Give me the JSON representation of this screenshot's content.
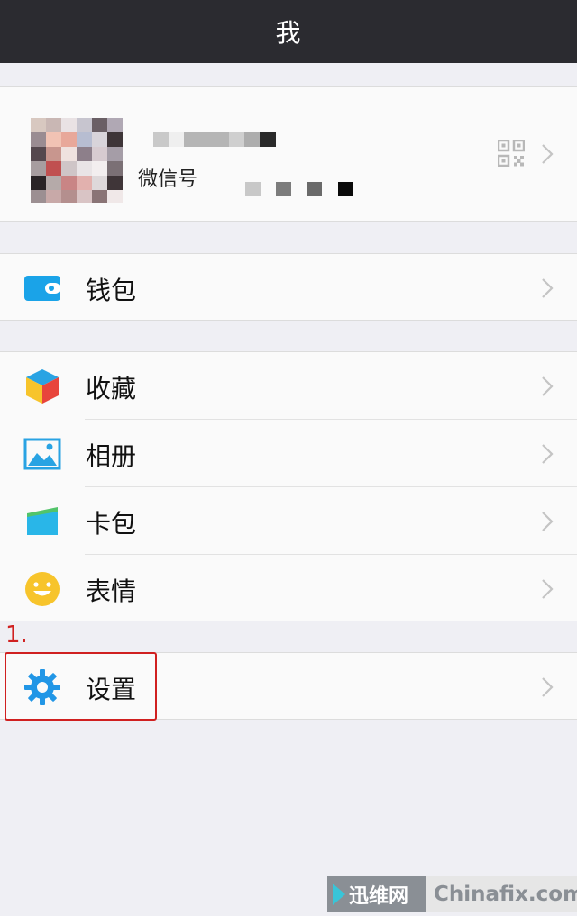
{
  "header": {
    "title": "我"
  },
  "profile": {
    "wechat_id_label": "微信号",
    "qr_icon": "qr-code-icon"
  },
  "menu": {
    "wallet": {
      "label": "钱包",
      "icon": "wallet-icon",
      "color": "#1aa3e8"
    },
    "favorites": {
      "label": "收藏",
      "icon": "cube-icon"
    },
    "album": {
      "label": "相册",
      "icon": "photo-icon",
      "color": "#29a3e3"
    },
    "cards": {
      "label": "卡包",
      "icon": "card-icon",
      "color": "#29b6e8"
    },
    "stickers": {
      "label": "表情",
      "icon": "smiley-icon",
      "color": "#f7c42b"
    },
    "settings": {
      "label": "设置",
      "icon": "gear-icon",
      "color": "#2196e6"
    }
  },
  "annotation": {
    "step": "1."
  },
  "watermark": {
    "left_text": "迅维网",
    "right_text": "Chinafix.com"
  }
}
